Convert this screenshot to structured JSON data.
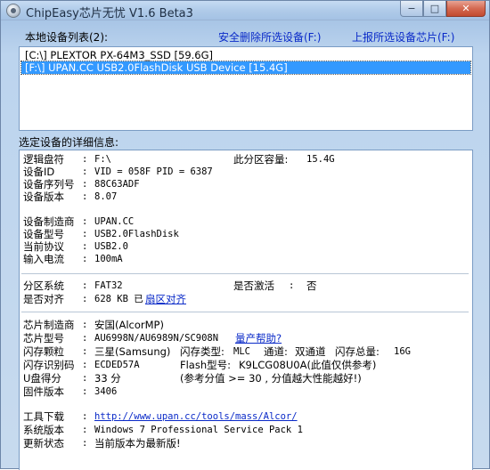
{
  "window": {
    "title": "ChipEasy芯片无忧 V1.6 Beta3",
    "btn_min": "−",
    "btn_max": "□",
    "btn_close": "✕"
  },
  "top": {
    "list_label": "本地设备列表(2):",
    "safe_delete_link": "安全删除所选设备(F:)",
    "report_link": "上报所选设备芯片(F:)"
  },
  "devices": [
    "[C:\\] PLEXTOR PX-64M3_SSD [59.6G]",
    "[F:\\] UPAN.CC USB2.0FlashDisk USB Device [15.4G]"
  ],
  "details_label": "选定设备的详细信息:",
  "details": {
    "drive_letter_key": "逻辑盘符",
    "drive_letter_val": "F:\\",
    "partition_size_key": "此分区容量:",
    "partition_size_val": "15.4G",
    "device_id_key": "设备ID",
    "device_id_val": "VID = 058F     PID = 6387",
    "serial_key": "设备序列号",
    "serial_val": "88C63ADF",
    "version_key": "设备版本",
    "version_val": "8.07",
    "vendor_key": "设备制造商",
    "vendor_val": "UPAN.CC",
    "model_key": "设备型号",
    "model_val": "USB2.0FlashDisk",
    "protocol_key": "当前协议",
    "protocol_val": "USB2.0",
    "current_key": "输入电流",
    "current_val": "100mA",
    "fs_key": "分区系统",
    "fs_val": "FAT32",
    "active_key": "是否激活",
    "active_val": "否",
    "aligned_key": "是否对齐",
    "aligned_val": "628 KB 已",
    "aligned_link": "扇区对齐",
    "chip_vendor_key": "芯片制造商",
    "chip_vendor_val": "安国(AlcorMP)",
    "chip_model_key": "芯片型号",
    "chip_model_val": "AU6998N/AU6989N/SC908N",
    "mp_help_link": "量产帮助?",
    "flash_key": "闪存颗粒",
    "flash_val": "三星(Samsung)",
    "flash_type_key": "闪存类型:",
    "flash_type_val": "MLC",
    "channel_key": "通道:",
    "channel_val": "双通道",
    "flash_total_key": "闪存总量:",
    "flash_total_val": "16G",
    "flash_id_key": "闪存识别码",
    "flash_id_val": "ECDED57A",
    "flash_model_key": "Flash型号:",
    "flash_model_val": "K9LCG08U0A(此值仅供参考)",
    "score_key": "U盘得分",
    "score_val": "33 分",
    "score_note": "(参考分值 >= 30 , 分值越大性能越好!)",
    "firmware_key": "固件版本",
    "firmware_val": "3406",
    "tool_key": "工具下载",
    "tool_url": "http://www.upan.cc/tools/mass/Alcor/",
    "os_key": "系统版本",
    "os_val": "Windows 7 Professional Service Pack 1",
    "update_key": "更新状态",
    "update_val": "当前版本为最新版!",
    "colon": ":"
  }
}
